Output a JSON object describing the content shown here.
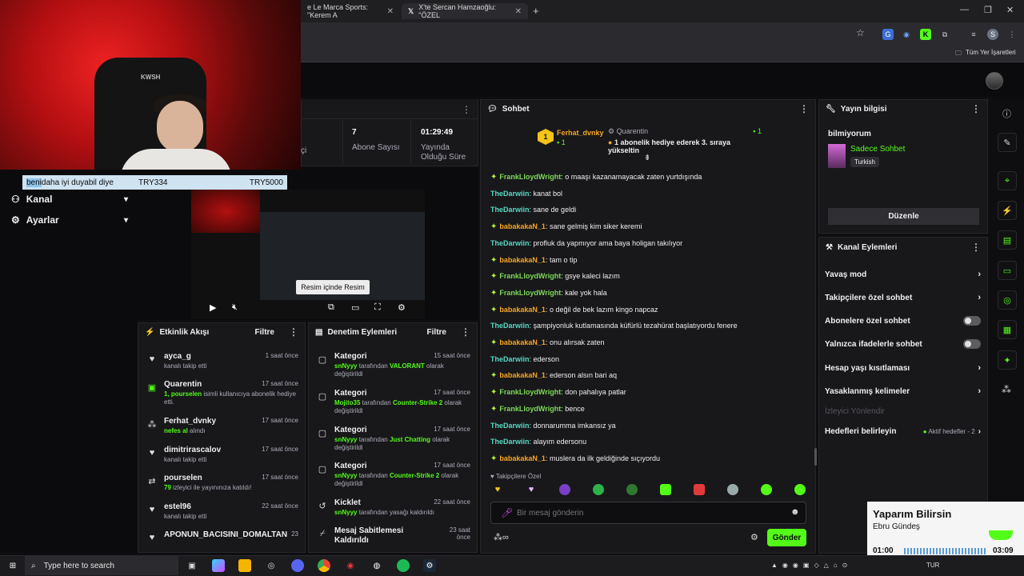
{
  "browser": {
    "tabs": [
      {
        "title": "e Le Marca Sports: \"Kerem A"
      },
      {
        "title": "X'te Sercan Hamzaoğlu: \"ÖZEL"
      }
    ],
    "new_tab": "+",
    "bookmarks_label": "Tüm Yer İşaretleri"
  },
  "webcam": {
    "label": "KWSH"
  },
  "donation": {
    "highlight": "beni",
    "message": " daha iyi duyabil diye",
    "amount": "TRY334",
    "goal": "TRY5000"
  },
  "sidebar": {
    "items": [
      {
        "label": "Kanal",
        "icon": "people-icon"
      },
      {
        "label": "Ayarlar",
        "icon": "gear-icon"
      }
    ]
  },
  "stats": {
    "partial_label": "çi",
    "subs_value": "7",
    "subs_label": "Abone Sayısı",
    "uptime_value": "01:29:49",
    "uptime_label": "Yayında Olduğu Süre"
  },
  "video": {
    "tooltip": "Resim içinde Resim"
  },
  "activity": {
    "title": "Etkinlik Akışı",
    "filter": "Filtre",
    "items": [
      {
        "name": "ayca_g",
        "desc": "kanalı takip etti",
        "time": "1 saat önce",
        "icon": "heart-icon"
      },
      {
        "name": "Quarentin",
        "desc_green": "1, pourselen",
        "desc": " isimli kullanıcıya abonelik hediye etti.",
        "time": "17 saat önce",
        "icon": "gift-icon"
      },
      {
        "name": "Ferhat_dvnky",
        "desc_green": "nefes al",
        "desc": " alındı",
        "time": "17 saat önce",
        "icon": "reward-icon"
      },
      {
        "name": "dimitrirascalov",
        "desc": "kanalı takip etti",
        "time": "17 saat önce",
        "icon": "heart-icon"
      },
      {
        "name": "pourselen",
        "desc_green": "79",
        "desc": " izleyici ile yayınınıza katıldı!",
        "time": "17 saat önce",
        "icon": "raid-icon"
      },
      {
        "name": "estel96",
        "desc": "kanalı takip etti",
        "time": "22 saat önce",
        "icon": "heart-icon"
      },
      {
        "name": "APONUN_BACISINI_DOMALTAN",
        "desc": "",
        "time": "23",
        "icon": "heart-icon"
      }
    ]
  },
  "moderation": {
    "title": "Denetim Eylemleri",
    "filter": "Filtre",
    "items": [
      {
        "title": "Kategori",
        "who": "snNyyy",
        "mid": " tarafından ",
        "what": "VALORANT",
        "rest": " olarak değiştirildi",
        "time": "15 saat önce",
        "icon": "category-icon"
      },
      {
        "title": "Kategori",
        "who": "Mojito35",
        "mid": " tarafından ",
        "what": "Counter-Strike 2",
        "rest": " olarak değiştirildi",
        "time": "17 saat önce",
        "icon": "category-icon"
      },
      {
        "title": "Kategori",
        "who": "snNyyy",
        "mid": " tarafından ",
        "what": "Just Chatting",
        "rest": " olarak değiştirildi",
        "time": "17 saat önce",
        "icon": "category-icon"
      },
      {
        "title": "Kategori",
        "who": "snNyyy",
        "mid": " tarafından ",
        "what": "Counter-Strike 2",
        "rest": " olarak değiştirildi",
        "time": "17 saat önce",
        "icon": "category-icon"
      },
      {
        "title": "Kicklet",
        "who": "snNyyy",
        "mid": " tarafından yasağı kaldırıldı",
        "what": "",
        "rest": "",
        "time": "22 saat önce",
        "icon": "undo-icon"
      },
      {
        "title": "Mesaj Sabitlemesi Kaldırıldı",
        "who": "",
        "mid": "",
        "what": "",
        "rest": "",
        "time": "23 saat önce",
        "icon": "unpin-icon"
      }
    ]
  },
  "chat": {
    "title": "Sohbet",
    "pinned": {
      "user": "Ferhat_dvnky",
      "user_count": "1",
      "gifter": "Quarentin",
      "gifter_count": "1",
      "note": "1 abonelik hediye ederek 3. sıraya yükseltin",
      "rank": "1"
    },
    "messages": [
      {
        "user": "FrankLloydWright",
        "color": "green",
        "badge": true,
        "text": "o maaşı kazanamayacak zaten yurtdışında"
      },
      {
        "user": "TheDarwiin",
        "color": "cyan",
        "badge": false,
        "text": "kanat bol"
      },
      {
        "user": "TheDarwiin",
        "color": "cyan",
        "badge": false,
        "text": "sane de geldi"
      },
      {
        "user": "babakakaN_1",
        "color": "orange",
        "badge": true,
        "text": "sane gelmiş kim siker keremi"
      },
      {
        "user": "TheDarwiin",
        "color": "cyan",
        "badge": false,
        "text": "profluk da yapmıyor ama baya holigan takılıyor"
      },
      {
        "user": "babakakaN_1",
        "color": "orange",
        "badge": true,
        "text": "tam o tip"
      },
      {
        "user": "FrankLloydWright",
        "color": "green",
        "badge": true,
        "text": "gsye kaleci lazım"
      },
      {
        "user": "FrankLloydWright",
        "color": "green",
        "badge": true,
        "text": "kale yok hala"
      },
      {
        "user": "babakakaN_1",
        "color": "orange",
        "badge": true,
        "text": "o değil de bek lazım kingo napcaz"
      },
      {
        "user": "TheDarwiin",
        "color": "cyan",
        "badge": false,
        "text": "şampiyonluk kutlamasında küfürlü tezahürat başlatıyordu fenere"
      },
      {
        "user": "babakakaN_1",
        "color": "orange",
        "badge": true,
        "text": "onu alırsak zaten"
      },
      {
        "user": "TheDarwiin",
        "color": "cyan",
        "badge": false,
        "text": "ederson"
      },
      {
        "user": "babakakaN_1",
        "color": "orange",
        "badge": true,
        "text": "ederson alsın bari aq"
      },
      {
        "user": "FrankLloydWright",
        "color": "green",
        "badge": true,
        "text": "don pahalıya patlar"
      },
      {
        "user": "FrankLloydWright",
        "color": "green",
        "badge": true,
        "text": "bence"
      },
      {
        "user": "TheDarwiin",
        "color": "cyan",
        "badge": false,
        "text": "donnarumma imkansız ya"
      },
      {
        "user": "TheDarwiin",
        "color": "cyan",
        "badge": false,
        "text": "alayım edersonu"
      },
      {
        "user": "babakakaN_1",
        "color": "orange",
        "badge": true,
        "text": "muslera da ilk geldiğinde sıçıyordu"
      }
    ],
    "followers_label": "Takipçilere Özel",
    "input_placeholder": "Bir mesaj gönderin",
    "send": "Gönder"
  },
  "stream_info": {
    "title": "Yayın bilgisi",
    "stream_title": "bilmiyorum",
    "category": "Sadece Sohbet",
    "language": "Turkish",
    "edit": "Düzenle"
  },
  "channel_actions": {
    "title": "Kanal Eylemleri",
    "items": [
      {
        "label": "Yavaş mod",
        "kind": "chevron"
      },
      {
        "label": "Takipçilere özel sohbet",
        "kind": "chevron"
      },
      {
        "label": "Abonelere özel sohbet",
        "kind": "toggle"
      },
      {
        "label": "Yalnızca ifadelerle sohbet",
        "kind": "toggle"
      },
      {
        "label": "Hesap yaşı kısıtlaması",
        "kind": "chevron"
      },
      {
        "label": "Yasaklanmış kelimeler",
        "kind": "chevron"
      }
    ],
    "section": "İzleyici Yönlendir",
    "goals_label": "Hedefleri belirleyin",
    "goals_status": "Aktif hedefler - 2"
  },
  "music": {
    "title": "Yaparım Bilirsin",
    "artist": "Ebru Gündeş",
    "elapsed": "01:00",
    "total": "03:09"
  },
  "taskbar": {
    "search_placeholder": "Type here to search",
    "lang": "TUR"
  }
}
